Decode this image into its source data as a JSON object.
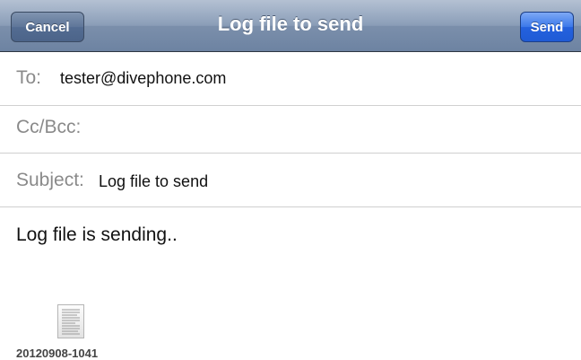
{
  "navbar": {
    "title": "Log file to send",
    "cancel_label": "Cancel",
    "send_label": "Send"
  },
  "fields": {
    "to_label": "To:",
    "to_value": "tester@divephone.com",
    "cc_label": "Cc/Bcc:",
    "subject_label": "Subject:",
    "subject_value": "Log file to send"
  },
  "body": {
    "text": "Log file is sending.."
  },
  "attachment": {
    "icon": "document-icon",
    "filename": "20120908-1041"
  },
  "colors": {
    "navbar": "#7b8fab",
    "send_button": "#2461de",
    "label_gray": "#8a8a8a"
  }
}
